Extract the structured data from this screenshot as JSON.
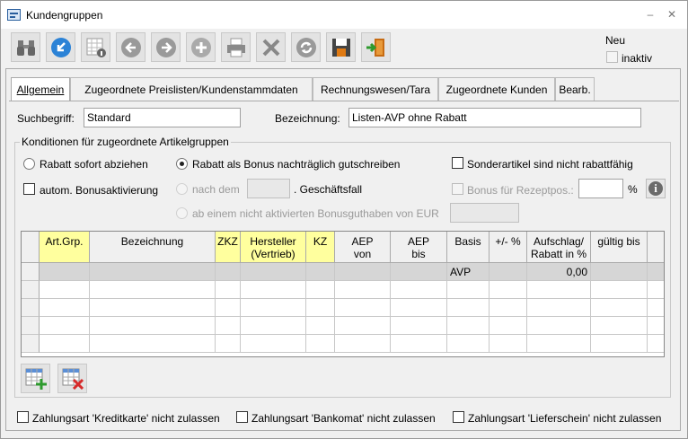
{
  "window": {
    "title": "Kundengruppen",
    "minimize": "–",
    "close": "✕"
  },
  "toolbar": {
    "buttons": [
      {
        "name": "search-button",
        "icon": "binoculars-icon"
      },
      {
        "name": "back-arrow-button",
        "icon": "return-arrow-icon"
      },
      {
        "name": "table-info-button",
        "icon": "table-info-icon"
      },
      {
        "name": "previous-button",
        "icon": "arrow-left-icon"
      },
      {
        "name": "next-button",
        "icon": "arrow-right-icon"
      },
      {
        "name": "add-button",
        "icon": "plus-icon"
      },
      {
        "name": "print-button",
        "icon": "printer-icon"
      },
      {
        "name": "delete-button",
        "icon": "x-icon"
      },
      {
        "name": "refresh-button",
        "icon": "refresh-icon"
      },
      {
        "name": "save-button",
        "icon": "floppy-disk-icon"
      },
      {
        "name": "exit-button",
        "icon": "exit-door-icon"
      }
    ],
    "neu_label": "Neu",
    "inaktiv_label": "inaktiv"
  },
  "tabs": [
    {
      "label": "Allgemein",
      "active": true
    },
    {
      "label": "Zugeordnete Preislisten/Kundenstammdaten",
      "active": false
    },
    {
      "label": "Rechnungswesen/Tara",
      "active": false
    },
    {
      "label": "Zugeordnete Kunden",
      "active": false
    },
    {
      "label": "Bearb.",
      "active": false
    }
  ],
  "form": {
    "suchbegriff_label": "Suchbegriff:",
    "suchbegriff_value": "Standard",
    "bezeichnung_label": "Bezeichnung:",
    "bezeichnung_value": "Listen-AVP ohne Rabatt"
  },
  "konditionen": {
    "title": "Konditionen für zugeordnete Artikelgruppen",
    "rabatt_sofort": "Rabatt sofort abziehen",
    "rabatt_bonus": "Rabatt als Bonus nachträglich gutschreiben",
    "sonderartikel": "Sonderartikel sind nicht rabattfähig",
    "autom_bonus": "autom. Bonusaktivierung",
    "nach_dem": "nach dem",
    "geschaeftsfall": ". Geschäftsfall",
    "bonus_rezept": "Bonus für Rezeptpos.:",
    "percent": "%",
    "ab_einem": "ab einem nicht aktivierten Bonusguthaben von EUR",
    "info": "i"
  },
  "grid": {
    "headers": [
      {
        "line1": "Art.Grp.",
        "line2": "",
        "yellow": true
      },
      {
        "line1": "Bezeichnung",
        "line2": "",
        "yellow": false
      },
      {
        "line1": "ZKZ",
        "line2": "",
        "yellow": true
      },
      {
        "line1": "Hersteller",
        "line2": "(Vertrieb)",
        "yellow": true
      },
      {
        "line1": "KZ",
        "line2": "",
        "yellow": true
      },
      {
        "line1": "AEP",
        "line2": "von",
        "yellow": false
      },
      {
        "line1": "AEP",
        "line2": "bis",
        "yellow": false
      },
      {
        "line1": "Basis",
        "line2": "",
        "yellow": false
      },
      {
        "line1": "+/- %",
        "line2": "",
        "yellow": false
      },
      {
        "line1": "Aufschlag/",
        "line2": "Rabatt in %",
        "yellow": false
      },
      {
        "line1": "gültig bis",
        "line2": "",
        "yellow": false
      }
    ],
    "rows": [
      [
        "",
        "",
        "",
        "",
        "",
        "",
        "",
        "AVP",
        "",
        "0,00",
        ""
      ],
      [
        "",
        "",
        "",
        "",
        "",
        "",
        "",
        "",
        "",
        "",
        ""
      ],
      [
        "",
        "",
        "",
        "",
        "",
        "",
        "",
        "",
        "",
        "",
        ""
      ],
      [
        "",
        "",
        "",
        "",
        "",
        "",
        "",
        "",
        "",
        "",
        ""
      ],
      [
        "",
        "",
        "",
        "",
        "",
        "",
        "",
        "",
        "",
        "",
        ""
      ]
    ]
  },
  "grid_buttons": [
    {
      "name": "add-row-button",
      "icon": "table-add-icon"
    },
    {
      "name": "delete-row-button",
      "icon": "table-delete-icon"
    }
  ],
  "footer": {
    "kreditkarte": "Zahlungsart 'Kreditkarte' nicht zulassen",
    "bankomat": "Zahlungsart 'Bankomat' nicht zulassen",
    "lieferschein": "Zahlungsart 'Lieferschein' nicht zulassen"
  },
  "colors": {
    "accent": "#2b82d6",
    "grid_yellow": "#ffff9e",
    "selected_row": "#d6d6d6"
  }
}
